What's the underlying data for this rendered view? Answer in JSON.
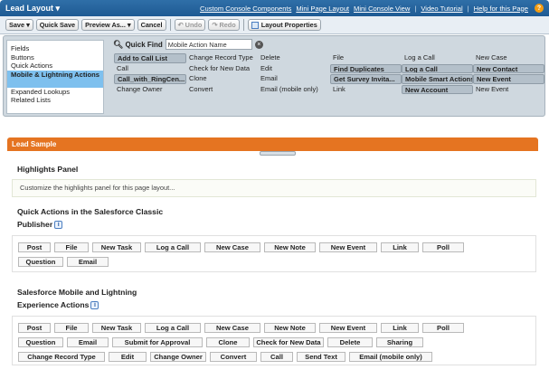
{
  "topbar": {
    "title": "Lead Layout",
    "links": [
      "Custom Console Components",
      "Mini Page Layout",
      "Mini Console View",
      "Video Tutorial",
      "Help for this Page"
    ],
    "separator": "|",
    "help_icon": "?"
  },
  "toolbar": {
    "save": "Save",
    "quick_save": "Quick Save",
    "preview_as": "Preview As...",
    "cancel": "Cancel",
    "undo": "Undo",
    "redo": "Redo",
    "layout_properties": "Layout Properties"
  },
  "palette": {
    "categories": [
      "Fields",
      "Buttons",
      "Quick Actions",
      "Mobile & Lightning Actions",
      "Expanded Lookups",
      "Related Lists"
    ],
    "selected_category": "Mobile & Lightning Actions",
    "quick_find_label": "Quick Find",
    "quick_find_value": "Mobile Action Name",
    "items": [
      [
        "Add to Call List",
        "Change Record Type",
        "Delete",
        "File",
        "Log a Call",
        "New Case"
      ],
      [
        "Call",
        "Check for New Data",
        "Edit",
        "Find Duplicates",
        "Log a Call",
        "New Contact"
      ],
      [
        "Call_with_RingCen...",
        "Clone",
        "Email",
        "Get Survey Invita...",
        "Mobile Smart Actions",
        "New Event"
      ],
      [
        "Change Owner",
        "Convert",
        "Email (mobile only)",
        "Link",
        "New Account",
        "New Event"
      ]
    ],
    "used": [
      [
        true,
        false,
        false,
        false,
        false,
        false
      ],
      [
        false,
        false,
        false,
        true,
        true,
        true
      ],
      [
        true,
        false,
        false,
        true,
        true,
        true
      ],
      [
        false,
        false,
        false,
        false,
        true,
        false
      ]
    ]
  },
  "layout": {
    "banner": "Lead Sample",
    "highlights_title": "Highlights Panel",
    "highlights_hint": "Customize the highlights panel for this page layout...",
    "quick_actions_title": "Quick Actions in the Salesforce Classic",
    "publisher_label": "Publisher",
    "publisher_actions": [
      "Post",
      "File",
      "New Task",
      "Log a Call",
      "New Case",
      "New Note",
      "New Event",
      "Link",
      "Poll",
      "Question",
      "Email"
    ],
    "sml_title": "Salesforce Mobile and Lightning",
    "experience_label": "Experience Actions",
    "experience_actions": [
      "Post",
      "File",
      "New Task",
      "Log a Call",
      "New Case",
      "New Note",
      "New Event",
      "Link",
      "Poll",
      "Question",
      "Email",
      "Submit for Approval",
      "Clone",
      "Check for New Data",
      "Delete",
      "Sharing",
      "Change Record Type",
      "Edit",
      "Change Owner",
      "Convert",
      "Call",
      "Send Text",
      "Email (mobile only)"
    ]
  }
}
